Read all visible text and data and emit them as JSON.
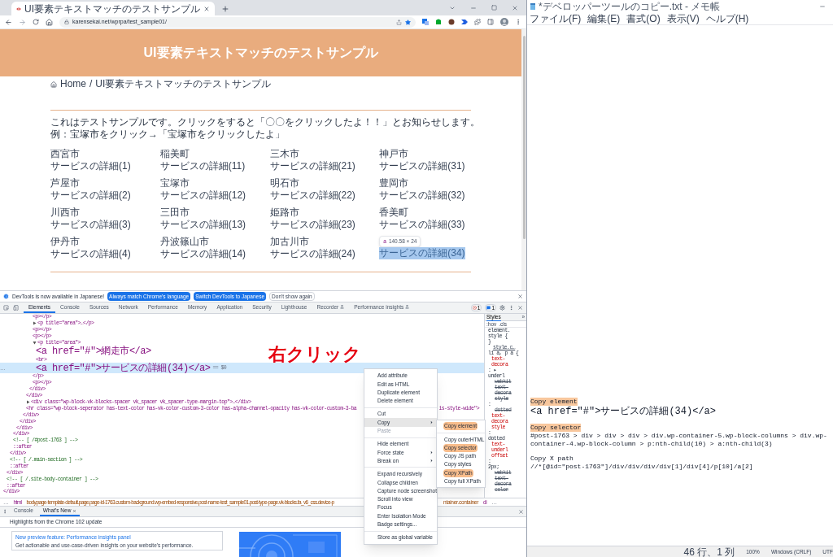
{
  "browser": {
    "tab_title": "UI要素テキストマッチのテストサンプル",
    "address": "karensekai.net/wprpa/test_sample01/"
  },
  "page": {
    "title": "UI要素テキストマッチのテストサンプル",
    "breadcrumb": [
      "Home",
      "UI要素テキストマッチのテストサンプル"
    ],
    "breadcrumb_separator": "/",
    "intro": "これはテストサンプルです。クリックをすると「〇〇をクリックしたよ！！」とお知らせします。例：宝塚市をクリック→「宝塚市をクリックしたよ」",
    "items": [
      {
        "city": "西宮市",
        "link": "サービスの詳細(1)",
        "highlighted": false
      },
      {
        "city": "稲美町",
        "link": "サービスの詳細(11)",
        "highlighted": false
      },
      {
        "city": "三木市",
        "link": "サービスの詳細(21)",
        "highlighted": false
      },
      {
        "city": "神戸市",
        "link": "サービスの詳細(31)",
        "highlighted": false
      },
      {
        "city": "芦屋市",
        "link": "サービスの詳細(2)",
        "highlighted": false
      },
      {
        "city": "宝塚市",
        "link": "サービスの詳細(12)",
        "highlighted": false
      },
      {
        "city": "明石市",
        "link": "サービスの詳細(22)",
        "highlighted": false
      },
      {
        "city": "豊岡市",
        "link": "サービスの詳細(32)",
        "highlighted": false
      },
      {
        "city": "川西市",
        "link": "サービスの詳細(3)",
        "highlighted": false
      },
      {
        "city": "三田市",
        "link": "サービスの詳細(13)",
        "highlighted": false
      },
      {
        "city": "姫路市",
        "link": "サービスの詳細(23)",
        "highlighted": false
      },
      {
        "city": "香美町",
        "link": "サービスの詳細(33)",
        "highlighted": false
      },
      {
        "city": "伊丹市",
        "link": "サービスの詳細(4)",
        "highlighted": false
      },
      {
        "city": "丹波篠山市",
        "link": "サービスの詳細(14)",
        "highlighted": false
      },
      {
        "city": "加古川市",
        "link": "サービスの詳細(24)",
        "highlighted": false
      },
      {
        "link": "サービスの詳細(34)",
        "highlighted": true
      }
    ],
    "tooltip": {
      "tag": "a",
      "size": "140.58 × 24"
    }
  },
  "devtools": {
    "banner": {
      "text": "DevTools is now available in Japanese!",
      "buttons": [
        "Always match Chrome's language",
        "Switch DevTools to Japanese"
      ],
      "dismiss": "Don't show again"
    },
    "tabs": [
      {
        "label": "Elements",
        "selected": true,
        "experimental": false
      },
      {
        "label": "Console",
        "selected": false,
        "experimental": false
      },
      {
        "label": "Sources",
        "selected": false,
        "experimental": false
      },
      {
        "label": "Network",
        "selected": false,
        "experimental": false
      },
      {
        "label": "Performance",
        "selected": false,
        "experimental": false
      },
      {
        "label": "Memory",
        "selected": false,
        "experimental": false
      },
      {
        "label": "Application",
        "selected": false,
        "experimental": false
      },
      {
        "label": "Security",
        "selected": false,
        "experimental": false
      },
      {
        "label": "Lighthouse",
        "selected": false,
        "experimental": false
      },
      {
        "label": "Recorder",
        "selected": false,
        "experimental": true
      },
      {
        "label": "Performance insights",
        "selected": false,
        "experimental": true
      }
    ],
    "error_count": "1",
    "message_count": "1",
    "tree": {
      "kind": "element",
      "close": "</div>",
      "children": [
        {
          "kind": "element",
          "close": "</div>",
          "children": [
            {
              "kind": "element",
              "close": "</div>",
              "children": [
                {
                  "kind": "element",
                  "close": "</div>",
                  "children": [
                    {
                      "kind": "element",
                      "close": "</div>",
                      "children": [
                        {
                          "kind": "element",
                          "close": "</div>",
                          "children": [
                            {
                              "kind": "element",
                              "close": "</div>",
                              "children": [
                                {
                                  "kind": "element",
                                  "close": "</div>",
                                  "children": [
                                    {
                                      "kind": "element",
                                      "close": "</div>",
                                      "children": [
                                        {
                                          "kind": "element",
                                          "open": "<p></p>"
                                        },
                                        {
                                          "kind": "element",
                                          "open": "<p title=\"area\">…</p>",
                                          "expanded": false
                                        },
                                        {
                                          "kind": "element",
                                          "open": "<p></p>"
                                        },
                                        {
                                          "kind": "element",
                                          "open": "<p></p>"
                                        },
                                        {
                                          "kind": "element",
                                          "open": "<p title=\"area\">",
                                          "expanded": true,
                                          "close": "</p>",
                                          "children": [
                                            {
                                              "kind": "element",
                                              "open": "<a href=\"#\">網走市</a>"
                                            },
                                            {
                                              "kind": "element",
                                              "open": "<br>"
                                            },
                                            {
                                              "kind": "element",
                                              "open": "<a href=\"#\">サービスの詳細(34)</a>",
                                              "selected": true,
                                              "gutter": "…",
                                              "suffix": "== $0"
                                            }
                                          ]
                                        },
                                        {
                                          "kind": "element",
                                          "open": "<p></p>"
                                        }
                                      ]
                                    }
                                  ]
                                },
                                {
                                  "kind": "element",
                                  "open": "<div class=\"wp-block-vk-blocks-spacer vk_spacer vk_spacer-type-margin-top\">…</div>",
                                  "expanded": false
                                },
                                {
                                  "kind": "element",
                                  "open": "<hr class=\"wp-block-seperator has-text-color has-vk-color-custom-3-color has-alpha-channel-opacity has-vk-color-custom-3-ba",
                                  "tail": "is-style-wide\">"
                                }
                              ]
                            }
                          ]
                        }
                      ]
                    }
                  ]
                },
                {
                  "kind": "comment",
                  "open": "<!-- [ /#post-1763 ] -->"
                },
                {
                  "kind": "pseudo",
                  "open": "::after"
                }
              ]
            },
            {
              "kind": "comment",
              "open": "<!-- [ /.main-section ] -->"
            },
            {
              "kind": "pseudo",
              "open": "::after"
            }
          ]
        },
        {
          "kind": "comment",
          "open": "<!-- [ /.site-body-container ] -->"
        },
        {
          "kind": "pseudo",
          "open": "::after"
        }
      ]
    },
    "styles_tab": "Styles",
    "styles_more": "»",
    "styles_filters": [
      ":hov",
      ".cls"
    ],
    "styles_lines": [
      {
        "text": "element.",
        "kind": "plain"
      },
      {
        "text": "style {",
        "kind": "plain"
      },
      {
        "text": "}",
        "kind": "plain"
      },
      {
        "text": "style.c…",
        "kind": "link"
      },
      {
        "text": "li a, p a {",
        "kind": "plain"
      },
      {
        "text": "text-",
        "kind": "prop"
      },
      {
        "text": "decora",
        "kind": "prop"
      },
      {
        "text": ": ▸",
        "kind": "plain"
      },
      {
        "text": "underl",
        "kind": "plain"
      },
      {
        "text": "webkit",
        "kind": "struck"
      },
      {
        "text": "text-",
        "kind": "struck"
      },
      {
        "text": "decora",
        "kind": "struck"
      },
      {
        "text": "style",
        "kind": "struck"
      },
      {
        "text": ":",
        "kind": "plain"
      },
      {
        "text": "dotted",
        "kind": "struck"
      },
      {
        "text": "text-",
        "kind": "prop"
      },
      {
        "text": "decora",
        "kind": "prop"
      },
      {
        "text": "style",
        "kind": "prop"
      },
      {
        "text": ":",
        "kind": "plain"
      },
      {
        "text": "dotted",
        "kind": "plain"
      },
      {
        "text": "text-",
        "kind": "prop"
      },
      {
        "text": "underl",
        "kind": "prop"
      },
      {
        "text": "offset",
        "kind": "prop"
      },
      {
        "text": ":",
        "kind": "plain"
      },
      {
        "text": "2px;",
        "kind": "plain"
      },
      {
        "text": "webkit",
        "kind": "struck"
      },
      {
        "text": "text-",
        "kind": "struck"
      },
      {
        "text": "decora",
        "kind": "struck"
      },
      {
        "text": "color",
        "kind": "struck"
      }
    ],
    "crumbs_start": "…",
    "crumbs": [
      {
        "text": "html",
        "kind": "tag"
      },
      {
        "text": "body.page-template-default.page.page-id-1763.custom-background.wp-embed-responsive.post-name-test_sample01.post-type-page.vk-blocks.fa_v6_css.device-p",
        "kind": "class"
      }
    ],
    "crumbs_after_menu": [
      {
        "text": "ntainer.container",
        "kind": "class"
      },
      {
        "text": "di",
        "kind": "tag"
      }
    ],
    "crumbs_end": "…",
    "drawer": {
      "tabs": [
        {
          "label": "Console",
          "selected": false,
          "closable": false
        },
        {
          "label": "What's New",
          "selected": true,
          "closable": true
        }
      ],
      "heading": "Highlights from the Chrome 102 update",
      "card": {
        "title": "New preview feature: Performance insights panel",
        "text": "Get actionable and use-case-driven insights on your website's performance."
      }
    },
    "context_menu": [
      [
        {
          "label": "Add attribute",
          "submenu": false,
          "disabled": false,
          "selected": false
        },
        {
          "label": "Edit as HTML",
          "submenu": false,
          "disabled": false,
          "selected": false
        },
        {
          "label": "Duplicate element",
          "submenu": false,
          "disabled": false,
          "selected": false
        },
        {
          "label": "Delete element",
          "submenu": false,
          "disabled": false,
          "selected": false
        }
      ],
      [
        {
          "label": "Cut",
          "submenu": false,
          "disabled": false,
          "selected": false
        },
        {
          "label": "Copy",
          "submenu": true,
          "disabled": false,
          "selected": true
        },
        {
          "label": "Paste",
          "submenu": false,
          "disabled": true,
          "selected": false
        }
      ],
      [
        {
          "label": "Hide element",
          "submenu": false,
          "disabled": false,
          "selected": false
        },
        {
          "label": "Force state",
          "submenu": true,
          "disabled": false,
          "selected": false
        },
        {
          "label": "Break on",
          "submenu": true,
          "disabled": false,
          "selected": false
        }
      ],
      [
        {
          "label": "Expand recursively",
          "submenu": false,
          "disabled": false,
          "selected": false
        },
        {
          "label": "Collapse children",
          "submenu": false,
          "disabled": false,
          "selected": false
        },
        {
          "label": "Capture node screenshot",
          "submenu": false,
          "disabled": false,
          "selected": false
        },
        {
          "label": "Scroll into view",
          "submenu": false,
          "disabled": false,
          "selected": false
        },
        {
          "label": "Focus",
          "submenu": false,
          "disabled": false,
          "selected": false
        },
        {
          "label": "Enter Isolation Mode",
          "submenu": false,
          "disabled": false,
          "selected": false
        },
        {
          "label": "Badge settings...",
          "submenu": false,
          "disabled": false,
          "selected": false
        }
      ],
      [
        {
          "label": "Store as global variable",
          "submenu": false,
          "disabled": false,
          "selected": false
        }
      ]
    ],
    "copy_submenu": [
      [
        {
          "label": "Copy element",
          "marked": true
        }
      ],
      [
        {
          "label": "Copy outerHTML",
          "marked": false
        },
        {
          "label": "Copy selector",
          "marked": true
        },
        {
          "label": "Copy JS path",
          "marked": false
        },
        {
          "label": "Copy styles",
          "marked": false
        },
        {
          "label": "Copy XPath",
          "marked": true
        },
        {
          "label": "Copy full XPath",
          "marked": false
        }
      ]
    ]
  },
  "annotation": "右クリック",
  "notepad": {
    "title": "*デベロッパーツールのコピー.txt - メモ帳",
    "menu": [
      "ファイル(F)",
      "編集(E)",
      "書式(O)",
      "表示(V)",
      "ヘルプ(H)"
    ],
    "entries": [
      {
        "heading": "Copy element",
        "marked": true,
        "value": "<a href=\"#\">サービスの詳細(34)</a>"
      },
      {
        "heading": "Copy selector",
        "marked": true,
        "value": "#post-1763 > div > div > div > div.wp-container-5.wp-block-columns > div.wp-container-4.wp-block-column > p:nth-child(10) > a:nth-child(3)"
      },
      {
        "heading": "Copy X path",
        "marked": false,
        "value": "//*[@id=\"post-1763\"]/div/div/div/div[1]/div[4]/p[10]/a[2]"
      }
    ],
    "status": [
      "46 行、1 列",
      "100%",
      "Windows (CRLF)",
      "UTF"
    ]
  }
}
